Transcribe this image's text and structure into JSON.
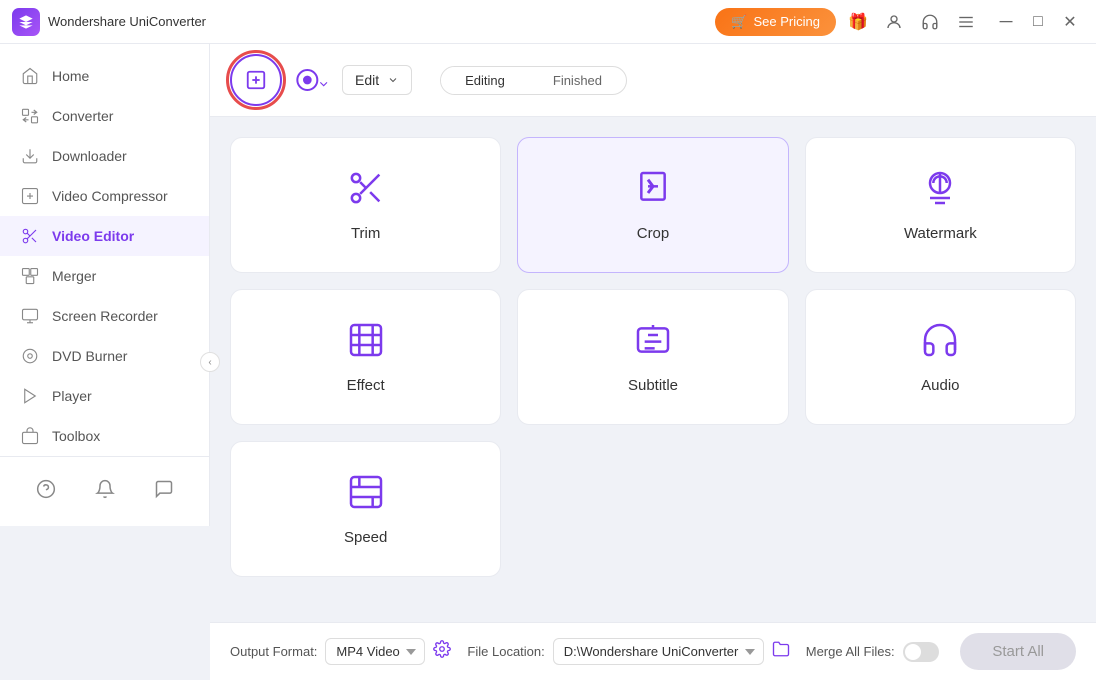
{
  "app": {
    "name": "Wondershare UniConverter"
  },
  "title_bar": {
    "see_pricing_label": "See Pricing",
    "gift_icon": "🎁",
    "minimize_icon": "─",
    "maximize_icon": "□",
    "close_icon": "✕",
    "menu_icon": "≡",
    "account_icon": "👤",
    "headset_icon": "🎧"
  },
  "sidebar": {
    "items": [
      {
        "id": "home",
        "label": "Home",
        "icon": "home"
      },
      {
        "id": "converter",
        "label": "Converter",
        "icon": "converter"
      },
      {
        "id": "downloader",
        "label": "Downloader",
        "icon": "downloader"
      },
      {
        "id": "video-compressor",
        "label": "Video Compressor",
        "icon": "compress"
      },
      {
        "id": "video-editor",
        "label": "Video Editor",
        "icon": "scissors",
        "active": true
      },
      {
        "id": "merger",
        "label": "Merger",
        "icon": "merger"
      },
      {
        "id": "screen-recorder",
        "label": "Screen Recorder",
        "icon": "screen"
      },
      {
        "id": "dvd-burner",
        "label": "DVD Burner",
        "icon": "dvd"
      },
      {
        "id": "player",
        "label": "Player",
        "icon": "player"
      },
      {
        "id": "toolbox",
        "label": "Toolbox",
        "icon": "toolbox"
      }
    ],
    "footer": {
      "help_icon": "?",
      "bell_icon": "🔔",
      "feedback_icon": "💬"
    }
  },
  "toolbar": {
    "edit_dropdown_label": "Edit",
    "tab_editing": "Editing",
    "tab_finished": "Finished"
  },
  "features": [
    {
      "id": "trim",
      "label": "Trim",
      "icon": "trim",
      "highlighted": false
    },
    {
      "id": "crop",
      "label": "Crop",
      "icon": "crop",
      "highlighted": true
    },
    {
      "id": "watermark",
      "label": "Watermark",
      "icon": "watermark",
      "highlighted": false
    },
    {
      "id": "effect",
      "label": "Effect",
      "icon": "effect",
      "highlighted": false
    },
    {
      "id": "subtitle",
      "label": "Subtitle",
      "icon": "subtitle",
      "highlighted": false
    },
    {
      "id": "audio",
      "label": "Audio",
      "icon": "audio",
      "highlighted": false
    },
    {
      "id": "speed",
      "label": "Speed",
      "icon": "speed",
      "highlighted": false
    }
  ],
  "bottom_bar": {
    "output_format_label": "Output Format:",
    "output_format_value": "MP4 Video",
    "file_location_label": "File Location:",
    "file_location_value": "D:\\Wondershare UniConverter",
    "merge_all_label": "Merge All Files:",
    "start_all_label": "Start All"
  }
}
